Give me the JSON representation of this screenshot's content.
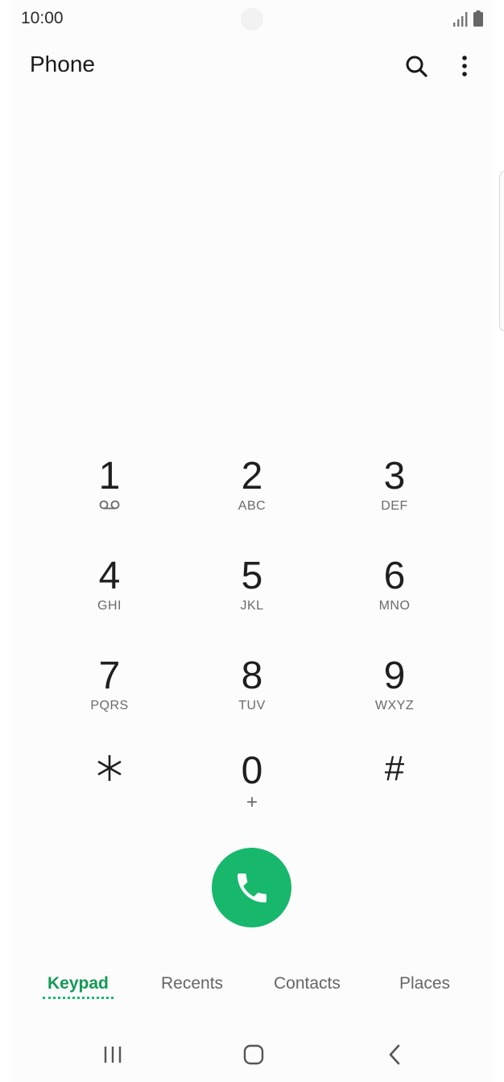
{
  "status_bar": {
    "time": "10:00",
    "icons": [
      "signal-icon",
      "battery-icon"
    ]
  },
  "header": {
    "title": "Phone",
    "actions": [
      "search-icon",
      "more-options-icon"
    ]
  },
  "keypad": {
    "keys": [
      {
        "digit": "1",
        "sub": "voicemail-icon"
      },
      {
        "digit": "2",
        "sub": "ABC"
      },
      {
        "digit": "3",
        "sub": "DEF"
      },
      {
        "digit": "4",
        "sub": "GHI"
      },
      {
        "digit": "5",
        "sub": "JKL"
      },
      {
        "digit": "6",
        "sub": "MNO"
      },
      {
        "digit": "7",
        "sub": "PQRS"
      },
      {
        "digit": "8",
        "sub": "TUV"
      },
      {
        "digit": "9",
        "sub": "WXYZ"
      },
      {
        "digit": "*",
        "sub": ""
      },
      {
        "digit": "0",
        "sub": "+"
      },
      {
        "digit": "#",
        "sub": ""
      }
    ]
  },
  "call_button": {
    "icon": "phone-icon",
    "color": "#17b86c"
  },
  "tabs": [
    {
      "label": "Keypad",
      "active": true
    },
    {
      "label": "Recents",
      "active": false
    },
    {
      "label": "Contacts",
      "active": false
    },
    {
      "label": "Places",
      "active": false
    }
  ],
  "nav_bar": [
    "recent-apps-icon",
    "home-icon",
    "back-icon"
  ],
  "colors": {
    "accent": "#17b86c",
    "accent_text": "#129a57"
  }
}
